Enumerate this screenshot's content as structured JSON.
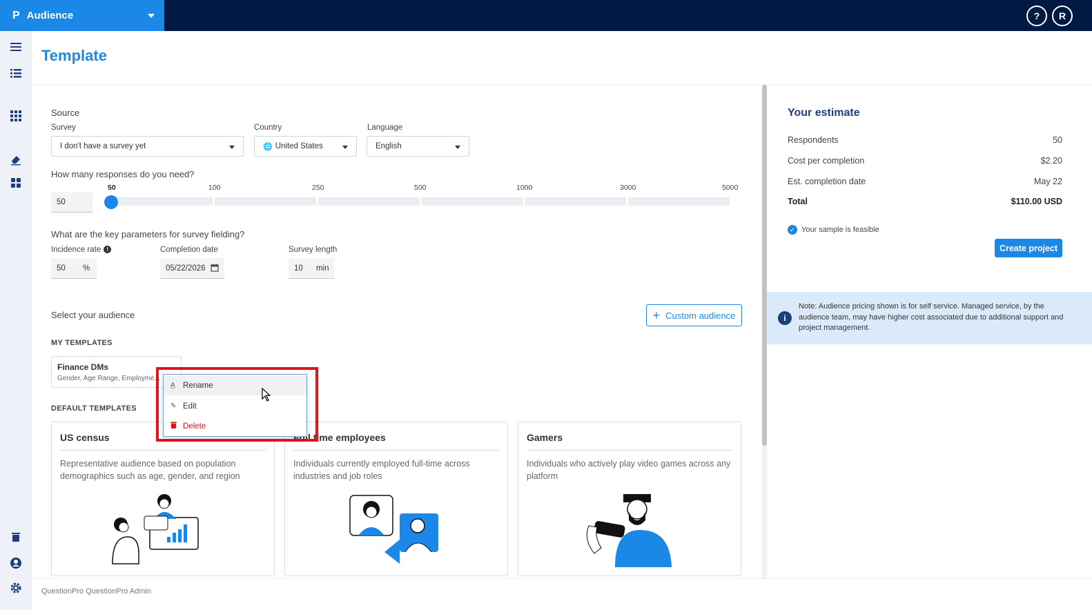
{
  "topbar": {
    "logo": "P",
    "app_name": "Audience",
    "help_label": "?",
    "user_initial": "R"
  },
  "page": {
    "title": "Template"
  },
  "source": {
    "heading": "Source",
    "survey_label": "Survey",
    "survey_value": "I don't have a survey yet",
    "country_label": "Country",
    "country_value": "United States",
    "language_label": "Language",
    "language_value": "English"
  },
  "responses": {
    "question": "How many responses do you need?",
    "value": "50",
    "ticks": [
      "50",
      "100",
      "250",
      "500",
      "1000",
      "3000",
      "5000"
    ]
  },
  "parameters": {
    "question": "What are the key parameters for survey fielding?",
    "incidence_label": "Incidence rate",
    "incidence_value": "50",
    "incidence_unit": "%",
    "completion_label": "Completion date",
    "completion_value": "05/22/2026",
    "length_label": "Survey length",
    "length_value": "10",
    "length_unit": "min"
  },
  "audience": {
    "heading": "Select your audience",
    "custom_button": "Custom audience",
    "my_templates_heading": "MY TEMPLATES",
    "my_templates": [
      {
        "title": "Finance DMs",
        "subtitle": "Gender, Age Range, Employme..."
      }
    ],
    "default_templates_heading": "DEFAULT TEMPLATES",
    "default_templates": [
      {
        "title": "US census",
        "description": "Representative audience based on population demographics such as age, gender, and region"
      },
      {
        "title": "Full time employees",
        "description": "Individuals currently employed full-time across industries and job roles"
      },
      {
        "title": "Gamers",
        "description": "Individuals who actively play video games across any platform"
      }
    ]
  },
  "context_menu": {
    "items": [
      {
        "label": "Rename",
        "icon": "rename-icon"
      },
      {
        "label": "Edit",
        "icon": "pencil-icon"
      },
      {
        "label": "Delete",
        "icon": "trash-icon"
      }
    ]
  },
  "estimate": {
    "title": "Your estimate",
    "rows": [
      {
        "label": "Respondents",
        "value": "50"
      },
      {
        "label": "Cost per completion",
        "value": "$2.20"
      },
      {
        "label": "Est. completion date",
        "value": "May 22"
      },
      {
        "label": "Total",
        "value": "$110.00 USD"
      }
    ],
    "feasible_text": "Your sample is feasible",
    "create_button": "Create project",
    "note": "Note: Audience pricing shown is for self service. Managed service, by the audience team, may have higher cost associated due to additional support and project management."
  },
  "footer": {
    "text": "QuestionPro QuestionPro Admin"
  },
  "colors": {
    "brand_blue": "#1b87e6",
    "navy": "#021a43",
    "danger": "#d6151c",
    "note_bg": "#dbeafb"
  }
}
